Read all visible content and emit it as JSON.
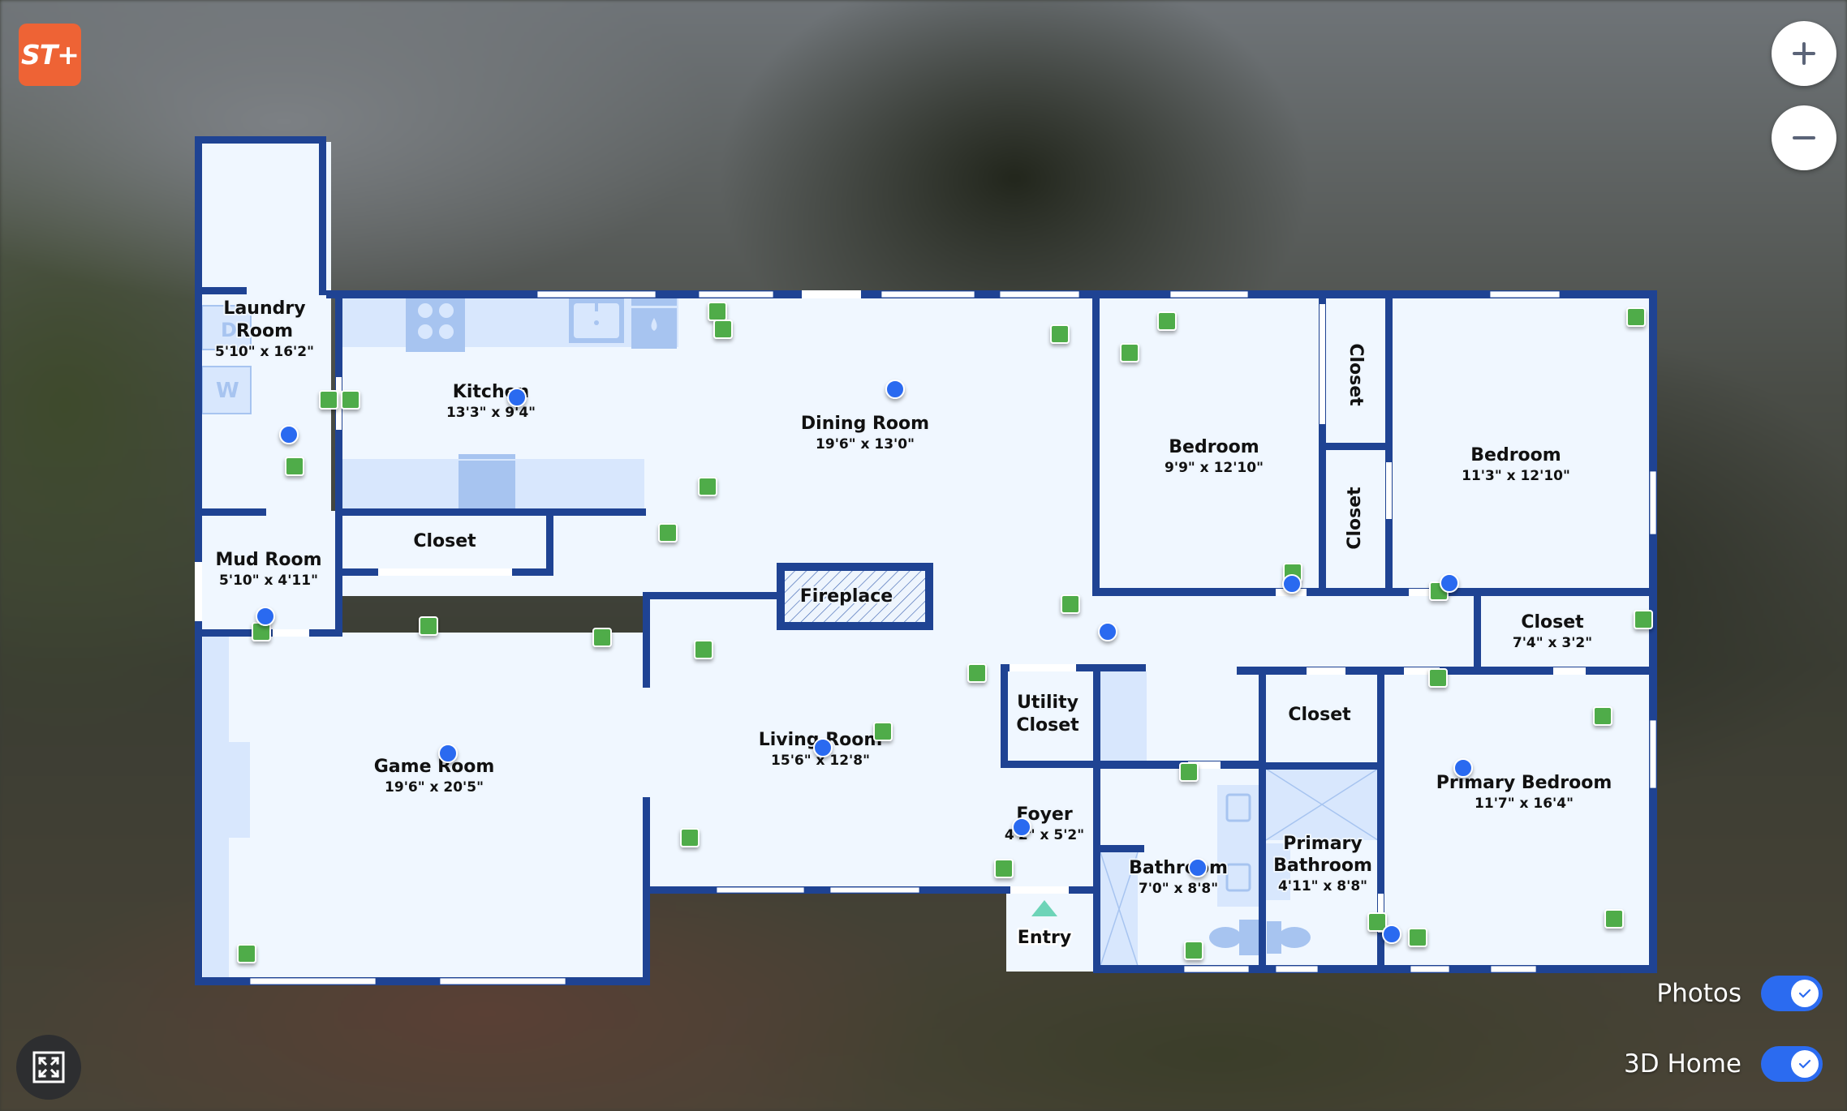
{
  "app": {
    "logo_text": "ST+",
    "colors": {
      "wall": "#1f4393",
      "floor": "#f0f7ff",
      "fixture": "#d8e7fd",
      "fixture_dark": "#a7c4f0",
      "photo_marker": "#4fac48",
      "pano_marker": "#2b6bf0",
      "entry_arrow": "#6dd4b8",
      "logo": "#ee6335",
      "toggle_on": "#2b6bf0"
    }
  },
  "controls": {
    "zoom_in_icon": "plus-icon",
    "zoom_out_icon": "minus-icon",
    "fullscreen_icon": "expand-icon"
  },
  "toggles": [
    {
      "label": "Photos",
      "on": true
    },
    {
      "label": "3D Home",
      "on": true
    }
  ],
  "floor_plan": {
    "entry_label": "Entry",
    "fireplace_label": "Fireplace",
    "rooms": [
      {
        "name": "Laundry",
        "name2": "Room",
        "dims": "5'10\" x 16'2\""
      },
      {
        "name": "Kitchen",
        "dims": "13'3\" x 9'4\""
      },
      {
        "name": "Dining Room",
        "dims": "19'6\" x 13'0\""
      },
      {
        "name": "Bedroom",
        "dims": "9'9\" x 12'10\""
      },
      {
        "name": "Closet",
        "dims": ""
      },
      {
        "name": "Closet",
        "dims": ""
      },
      {
        "name": "Bedroom",
        "dims": "11'3\" x 12'10\""
      },
      {
        "name": "Mud Room",
        "dims": "5'10\" x 4'11\""
      },
      {
        "name": "Closet",
        "dims": ""
      },
      {
        "name": "Closet",
        "dims": "7'4\" x 3'2\""
      },
      {
        "name": "Game Room",
        "dims": "19'6\" x 20'5\""
      },
      {
        "name": "Living Room",
        "dims": "15'6\" x 12'8\""
      },
      {
        "name": "Utility",
        "name2": "Closet",
        "dims": ""
      },
      {
        "name": "Closet",
        "dims": ""
      },
      {
        "name": "Primary Bedroom",
        "dims": "11'7\" x 16'4\""
      },
      {
        "name": "Foyer",
        "dims": "4'2\" x 5'2\""
      },
      {
        "name": "Bathroom",
        "dims": "7'0\" x 8'8\""
      },
      {
        "name": "Primary",
        "name2": "Bathroom",
        "dims": "4'11\" x 8'8\""
      }
    ],
    "appliance_labels": {
      "dryer": "D",
      "washer": "W"
    },
    "photo_marker_count": 35,
    "pano_marker_count": 14
  }
}
